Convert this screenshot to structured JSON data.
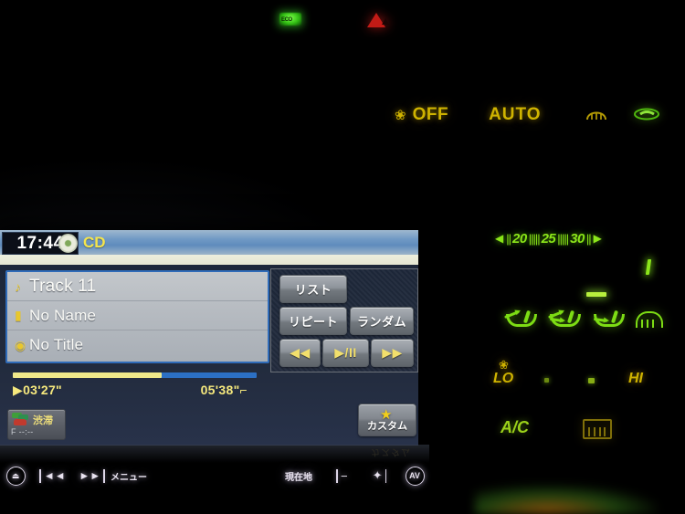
{
  "indicators": {
    "eco_lamp": "ECO",
    "hazard_lamp": "▲"
  },
  "climate": {
    "fan_icon": "fan-icon",
    "fan_status": "OFF",
    "auto_label": "AUTO",
    "front_defrost_icon": "front-defrost-icon",
    "seat_heater_icon": "seat-heater-icon",
    "temp_scale": {
      "left_arrow": "◀",
      "right_arrow": "▶",
      "ticks": "||",
      "values": [
        "20",
        "25",
        "30"
      ]
    },
    "airflow_modes": [
      "face",
      "face-and-feet",
      "feet",
      "defrost"
    ],
    "airflow_selected_index": 2,
    "fan_speed": {
      "low_label": "LO",
      "high_label": "HI",
      "steps": 2
    },
    "ac_label": "A/C",
    "rear_defogger_icon": "rear-defogger-icon"
  },
  "screen": {
    "header": {
      "clock": "17:44",
      "source_icon": "cd-disc-icon",
      "source_label": "CD"
    },
    "track_info": [
      {
        "icon": "♪",
        "icon_name": "music-note-icon",
        "text": "Track 11"
      },
      {
        "icon": "▮",
        "icon_name": "artist-icon",
        "text": "No Name"
      },
      {
        "icon": "◉",
        "icon_name": "album-icon",
        "text": "No Title"
      }
    ],
    "buttons": {
      "list": "リスト",
      "repeat": "リピート",
      "random": "ランダム",
      "prev": "◀◀",
      "play_pause": "▶/II",
      "next": "▶▶"
    },
    "progress": {
      "current_time": "▶03'27\"",
      "total_time": "05'38\"",
      "corner_mark": "⌐",
      "percent": 61
    },
    "traffic_button": {
      "label": "渋滞",
      "eta": "F --:--",
      "icon": "traffic-cars-icon"
    },
    "custom_button": {
      "label": "カスタム",
      "star_icon": "★"
    }
  },
  "hardware_buttons": {
    "power": "⏻",
    "prev": "◄◄",
    "next": "►►",
    "menu": "メニュー",
    "current_location": "現在地",
    "volume_down": "−",
    "volume_up": "✦",
    "av": "AV"
  },
  "colors": {
    "amber": "#cfb300",
    "green": "#8ce61b",
    "yellow_text": "#f5e54d",
    "progress_fill": "#f0e98a",
    "progress_track": "#2c70c4",
    "header_blue": "#6f98c4"
  }
}
